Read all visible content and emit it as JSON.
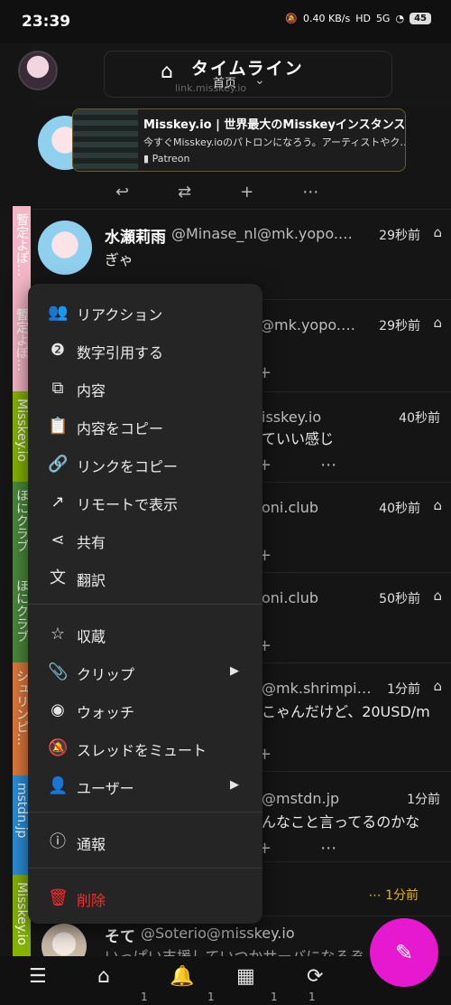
{
  "status": {
    "time": "23:39",
    "net": "0.40 KB/s",
    "hd": "HD",
    "sig": "5G",
    "battery": "45"
  },
  "header": {
    "title": "タイムライン",
    "subtitle": "首页",
    "link": "link.misskey.io"
  },
  "strip": [
    {
      "label": "暫定よぽ…",
      "color": "#f4b6c6"
    },
    {
      "label": "暫定よぽ…",
      "color": "#f4b6c6"
    },
    {
      "label": "Misskey.io",
      "color": "#86b300"
    },
    {
      "label": "ほにクラブ",
      "color": "#4a8a3c"
    },
    {
      "label": "ほにクラブ",
      "color": "#4a8a3c"
    },
    {
      "label": "シュリンピ…",
      "color": "#e07a3a"
    },
    {
      "label": "mstdn.jp",
      "color": "#2b90d9"
    },
    {
      "label": "Misskey.io",
      "color": "#86b300"
    }
  ],
  "preview": {
    "title": "Misskey.io | 世界最大のMisskeyインスタンス…",
    "desc": "今すぐMisskey.ioのパトロンになろう。アーティストやク…",
    "site": "Patreon"
  },
  "notes": [
    {
      "name": "水瀬莉雨",
      "handle": "@Minase_nl@mk.yopo.…",
      "ago": "29秒前",
      "body": "ぎゃ"
    },
    {
      "handle": "@mk.yopo.…",
      "ago": "29秒前"
    },
    {
      "handle": "isskey.io",
      "ago": "40秒前",
      "body": "ていい感じ"
    },
    {
      "handle": "oni.club",
      "ago": "40秒前"
    },
    {
      "handle": "oni.club",
      "ago": "50秒前"
    },
    {
      "handle": "@mk.shrimpi…",
      "ago": "1分前",
      "body": "こゃんだけど、20USD/m"
    },
    {
      "handle": "@mstdn.jp",
      "ago": "1分前",
      "body": "んなこと言ってるのかな"
    },
    {
      "ago": "1分前"
    },
    {
      "name": "そて",
      "handle": "@Soterio@misskey.io",
      "body": "いっぱい支援していつかサーバになるぞ"
    }
  ],
  "menu": {
    "items": [
      {
        "icon": "users-icon",
        "glyph": "👥",
        "label": "リアクション"
      },
      {
        "icon": "quote-icon",
        "glyph": "❷",
        "label": "数字引用する"
      },
      {
        "icon": "copy-icon",
        "glyph": "⧉",
        "label": "内容"
      },
      {
        "icon": "clipboard-icon",
        "glyph": "📋",
        "label": "内容をコピー"
      },
      {
        "icon": "link-icon",
        "glyph": "🔗",
        "label": "リンクをコピー"
      },
      {
        "icon": "external-link-icon",
        "glyph": "↗",
        "label": "リモートで表示"
      },
      {
        "icon": "share-icon",
        "glyph": "⋖",
        "label": "共有"
      },
      {
        "icon": "translate-icon",
        "glyph": "文",
        "label": "翻訳"
      },
      {
        "icon": "star-icon",
        "glyph": "☆",
        "label": "収蔵"
      },
      {
        "icon": "paperclip-icon",
        "glyph": "📎",
        "label": "クリップ"
      },
      {
        "icon": "eye-icon",
        "glyph": "◉",
        "label": "ウォッチ"
      },
      {
        "icon": "mute-icon",
        "glyph": "🔕",
        "label": "スレッドをミュート"
      },
      {
        "icon": "user-icon",
        "glyph": "👤",
        "label": "ユーザー"
      },
      {
        "icon": "report-icon",
        "glyph": "ⓘ",
        "label": "通報"
      },
      {
        "icon": "trash-icon",
        "glyph": "🗑",
        "label": "削除"
      }
    ]
  },
  "bottom": {
    "counts": [
      "1",
      "1",
      "1",
      "1"
    ]
  },
  "colors": {
    "fab": "#e619d0",
    "danger": "#ff2a2a"
  }
}
